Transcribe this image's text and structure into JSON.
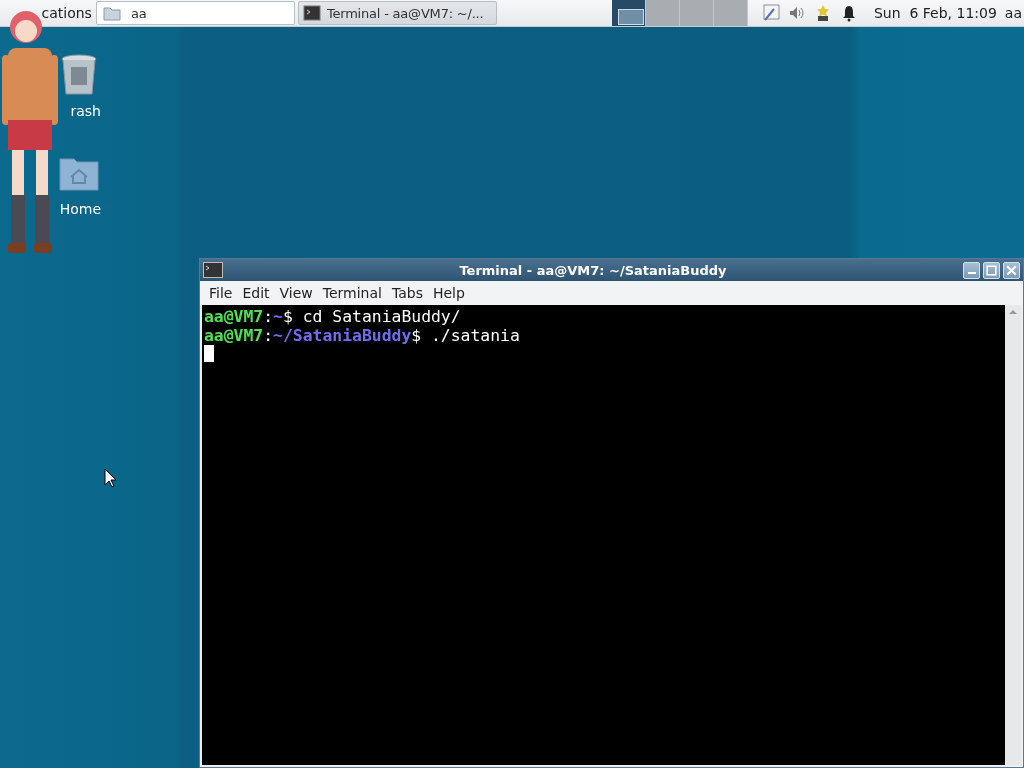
{
  "panel": {
    "app_menu": {
      "label": "cations"
    },
    "tasks": [
      {
        "title": "aa",
        "kind": "folder",
        "selected": false
      },
      {
        "title": "Terminal - aa@VM7: ~/...",
        "kind": "terminal",
        "selected": true
      }
    ],
    "workspaces": [
      {
        "selected": true
      },
      {
        "selected": false
      },
      {
        "selected": false
      },
      {
        "selected": false
      }
    ],
    "clock": "Sun  6 Feb, 11:09",
    "user": "aa"
  },
  "desktop": {
    "icons": [
      {
        "label": "rash",
        "kind": "trash"
      },
      {
        "label": "Home",
        "kind": "home"
      }
    ]
  },
  "terminal": {
    "title": "Terminal - aa@VM7: ~/SataniaBuddy",
    "menu": [
      "File",
      "Edit",
      "View",
      "Terminal",
      "Tabs",
      "Help"
    ],
    "lines": [
      {
        "user": "aa@VM7",
        "sep": ":",
        "path": "~",
        "prompt_end": "$",
        "command": " cd SataniaBuddy/"
      },
      {
        "user": "aa@VM7",
        "sep": ":",
        "path": "~/SataniaBuddy",
        "prompt_end": "$",
        "command": " ./satania"
      }
    ],
    "cursor": true
  }
}
